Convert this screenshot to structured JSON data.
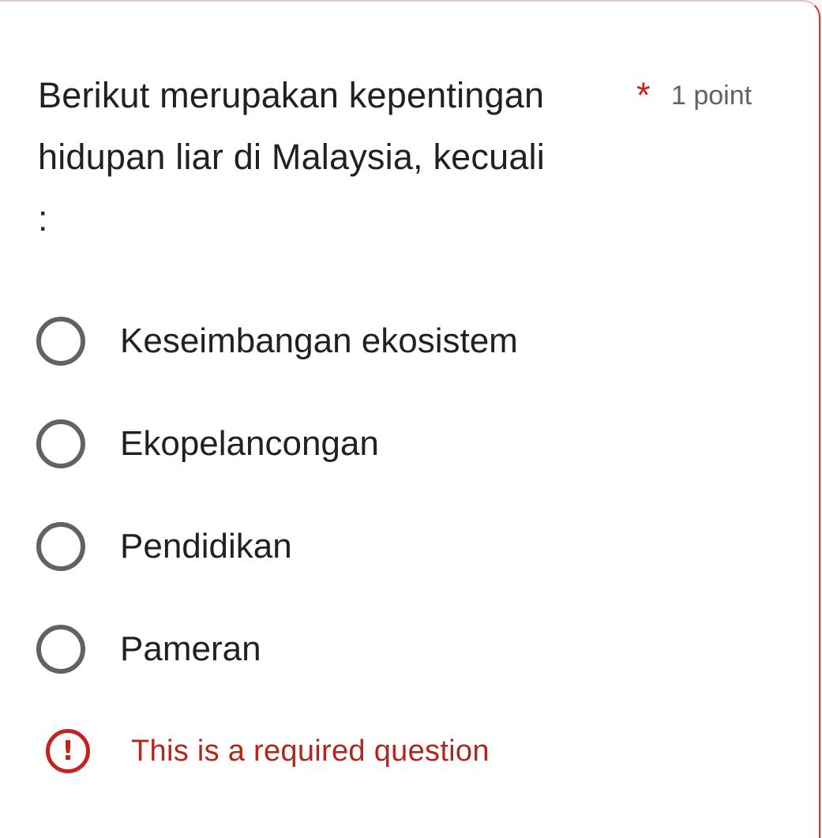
{
  "question": {
    "title": "Berikut merupakan kepentingan hidupan liar di Malaysia, kecuali\n:",
    "required_mark": "*",
    "points": "1 point"
  },
  "options": [
    {
      "label": "Keseimbangan ekosistem"
    },
    {
      "label": "Ekopelancongan"
    },
    {
      "label": "Pendidikan"
    },
    {
      "label": "Pameran"
    }
  ],
  "validation": {
    "icon": "!",
    "message": "This is a required question"
  },
  "colors": {
    "required": "#c5221f",
    "error": "#b3261e",
    "radio_outline": "#5f6368",
    "text": "#202124"
  }
}
